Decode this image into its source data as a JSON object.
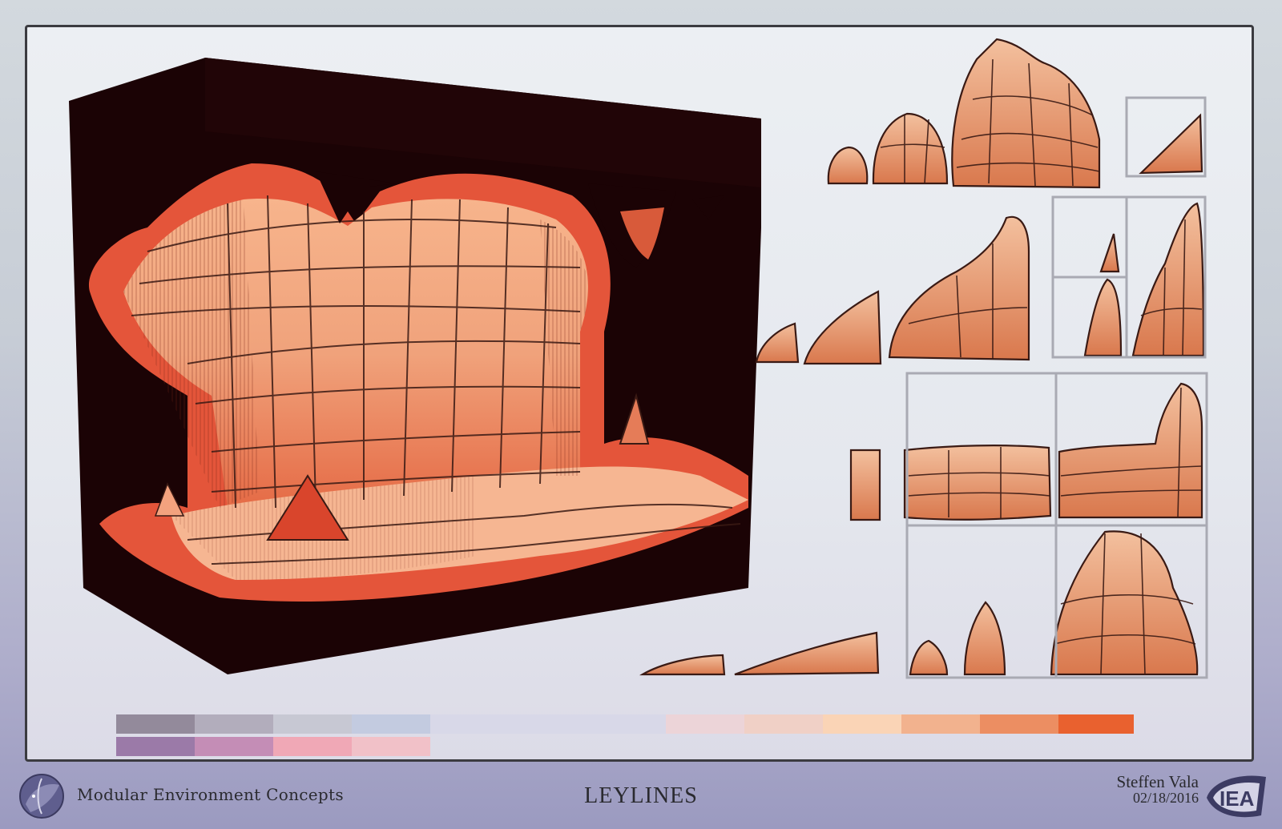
{
  "document": {
    "subtitle": "Modular Environment Concepts",
    "title": "LEYLINES",
    "author": "Steffen Vala",
    "date": "02/18/2016",
    "logo_text": "IEA"
  },
  "palette": {
    "row1": [
      "#938a9b",
      "#b2adbc",
      "#c7c8d3",
      "#c3cbe0",
      "#d8d8e8",
      "#d8d8e8",
      "#d8d8e8",
      "#ecd4d8",
      "#f0d0c6",
      "#fad4b6",
      "#f2b28e",
      "#ec8e62",
      "#e9612f"
    ],
    "row2": [
      "#9b7aa8",
      "#c48db6",
      "#f0a8b6",
      "#f1c1c8"
    ]
  },
  "colors": {
    "rock_light": "#f2b591",
    "rock_mid": "#e49a72",
    "rock_dark": "#c96f48",
    "cave_red": "#e4553a",
    "cave_void": "#1b0305",
    "ink": "#3a1a14"
  }
}
